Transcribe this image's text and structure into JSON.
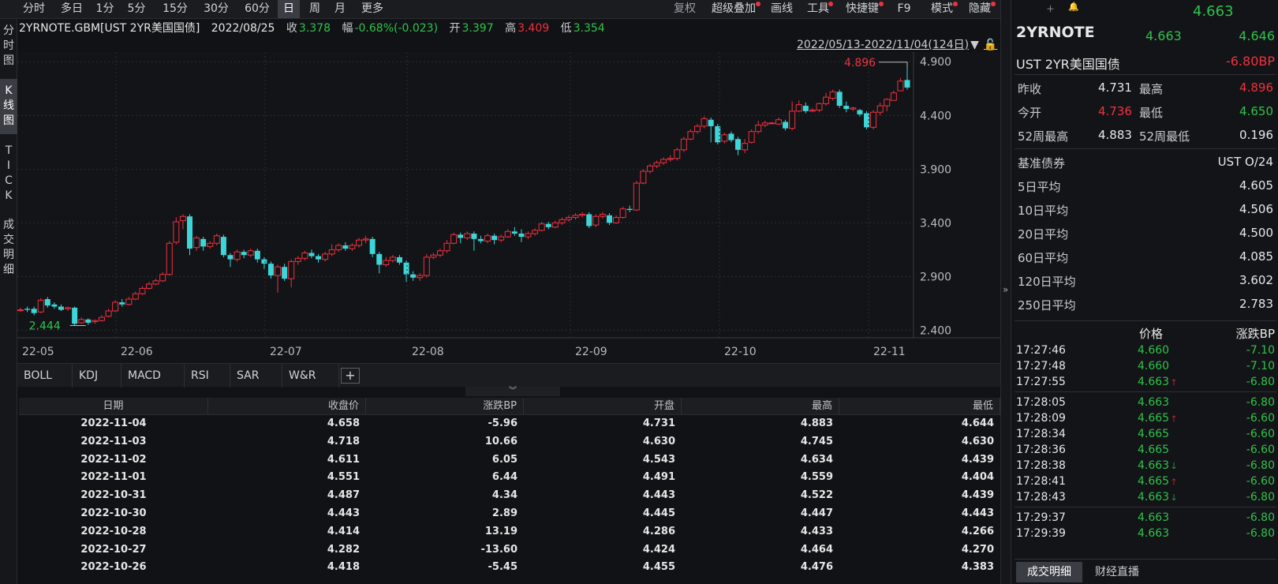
{
  "toolbar": {
    "periods": [
      "分时",
      "多日",
      "1分",
      "5分",
      "15分",
      "30分",
      "60分",
      "日",
      "周",
      "月",
      "更多"
    ],
    "active_period": "日",
    "tools": [
      "复权",
      "超级叠加",
      "画线",
      "工具",
      "快捷键",
      "F9",
      "模式",
      "隐藏"
    ]
  },
  "left_tabs": {
    "t1": "分时图",
    "t2": "K线图",
    "t3": "TICK",
    "t4": "成交明细",
    "active": "K线图"
  },
  "info": {
    "code": "2YRNOTE.GBM[UST 2YR美国国债]",
    "date": "2022/08/25",
    "close_label": "收",
    "close": "3.378",
    "change_label": "幅",
    "change": "-0.68%(-0.023)",
    "open_label": "开",
    "open": "3.397",
    "high_label": "高",
    "high": "3.409",
    "low_label": "低",
    "low": "3.354"
  },
  "range_text": "2022/05/13-2022/11/04(124日)",
  "chart_data": {
    "type": "candlestick",
    "y_ticks": [
      "4.900",
      "4.400",
      "3.900",
      "3.400",
      "2.900",
      "2.400"
    ],
    "x_labels": [
      "22-05",
      "22-06",
      "22-07",
      "22-08",
      "22-09",
      "22-10",
      "22-11"
    ],
    "ylim": [
      2.33,
      4.99
    ],
    "max_label": "4.896",
    "min_label": "2.444",
    "candles": [
      [
        2.59,
        2.59,
        2.61,
        2.57
      ],
      [
        2.6,
        2.59,
        2.62,
        2.57
      ],
      [
        2.6,
        2.56,
        2.62,
        2.54
      ],
      [
        2.57,
        2.68,
        2.7,
        2.56
      ],
      [
        2.69,
        2.63,
        2.71,
        2.61
      ],
      [
        2.64,
        2.62,
        2.66,
        2.6
      ],
      [
        2.62,
        2.59,
        2.64,
        2.58
      ],
      [
        2.6,
        2.61,
        2.62,
        2.58
      ],
      [
        2.61,
        2.46,
        2.62,
        2.44
      ],
      [
        2.47,
        2.5,
        2.52,
        2.46
      ],
      [
        2.5,
        2.47,
        2.51,
        2.45
      ],
      [
        2.48,
        2.49,
        2.5,
        2.46
      ],
      [
        2.49,
        2.52,
        2.54,
        2.48
      ],
      [
        2.53,
        2.58,
        2.6,
        2.52
      ],
      [
        2.58,
        2.66,
        2.68,
        2.57
      ],
      [
        2.66,
        2.64,
        2.69,
        2.62
      ],
      [
        2.64,
        2.69,
        2.71,
        2.63
      ],
      [
        2.69,
        2.74,
        2.76,
        2.68
      ],
      [
        2.74,
        2.79,
        2.81,
        2.73
      ],
      [
        2.79,
        2.83,
        2.85,
        2.78
      ],
      [
        2.83,
        2.86,
        2.88,
        2.82
      ],
      [
        2.86,
        2.92,
        2.94,
        2.85
      ],
      [
        2.92,
        3.21,
        3.23,
        2.91
      ],
      [
        3.22,
        3.41,
        3.45,
        3.2
      ],
      [
        3.42,
        3.46,
        3.48,
        3.34
      ],
      [
        3.46,
        3.16,
        3.48,
        3.1
      ],
      [
        3.17,
        3.26,
        3.28,
        3.14
      ],
      [
        3.25,
        3.18,
        3.27,
        3.14
      ],
      [
        3.18,
        3.21,
        3.23,
        3.16
      ],
      [
        3.21,
        3.28,
        3.3,
        3.19
      ],
      [
        3.27,
        3.1,
        3.29,
        3.08
      ],
      [
        3.1,
        3.06,
        3.12,
        2.99
      ],
      [
        3.06,
        3.13,
        3.15,
        3.04
      ],
      [
        3.13,
        3.1,
        3.15,
        3.07
      ],
      [
        3.1,
        3.14,
        3.16,
        3.08
      ],
      [
        3.14,
        3.06,
        3.16,
        3.03
      ],
      [
        3.06,
        3.02,
        3.08,
        2.97
      ],
      [
        3.02,
        2.91,
        3.04,
        2.88
      ],
      [
        2.91,
        2.99,
        3.01,
        2.75
      ],
      [
        2.99,
        2.88,
        3.02,
        2.86
      ],
      [
        2.88,
        3.04,
        3.06,
        2.8
      ],
      [
        3.04,
        3.07,
        3.09,
        3.01
      ],
      [
        3.07,
        3.12,
        3.14,
        3.05
      ],
      [
        3.12,
        3.09,
        3.15,
        3.07
      ],
      [
        3.09,
        3.06,
        3.11,
        3.03
      ],
      [
        3.06,
        3.11,
        3.13,
        3.04
      ],
      [
        3.11,
        3.15,
        3.2,
        3.09
      ],
      [
        3.15,
        3.19,
        3.21,
        3.13
      ],
      [
        3.19,
        3.16,
        3.22,
        3.14
      ],
      [
        3.16,
        3.19,
        3.21,
        3.14
      ],
      [
        3.19,
        3.24,
        3.26,
        3.17
      ],
      [
        3.24,
        3.25,
        3.28,
        3.21
      ],
      [
        3.25,
        3.11,
        3.27,
        3.08
      ],
      [
        3.11,
        3.01,
        3.13,
        2.93
      ],
      [
        3.01,
        3.05,
        3.08,
        2.99
      ],
      [
        3.05,
        3.08,
        3.1,
        3.03
      ],
      [
        3.08,
        3.03,
        3.1,
        3.01
      ],
      [
        3.03,
        2.92,
        3.05,
        2.85
      ],
      [
        2.92,
        2.89,
        2.95,
        2.86
      ],
      [
        2.89,
        2.91,
        2.93,
        2.86
      ],
      [
        2.91,
        3.08,
        3.11,
        2.89
      ],
      [
        3.08,
        3.1,
        3.12,
        3.06
      ],
      [
        3.1,
        3.14,
        3.16,
        3.08
      ],
      [
        3.14,
        3.21,
        3.24,
        3.12
      ],
      [
        3.21,
        3.29,
        3.31,
        3.2
      ],
      [
        3.29,
        3.26,
        3.31,
        3.21
      ],
      [
        3.26,
        3.3,
        3.32,
        3.24
      ],
      [
        3.3,
        3.25,
        3.32,
        3.14
      ],
      [
        3.25,
        3.23,
        3.28,
        3.21
      ],
      [
        3.23,
        3.28,
        3.3,
        3.21
      ],
      [
        3.28,
        3.24,
        3.3,
        3.2
      ],
      [
        3.24,
        3.27,
        3.29,
        3.22
      ],
      [
        3.27,
        3.32,
        3.34,
        3.26
      ],
      [
        3.32,
        3.3,
        3.36,
        3.28
      ],
      [
        3.3,
        3.27,
        3.34,
        3.22
      ],
      [
        3.27,
        3.3,
        3.32,
        3.25
      ],
      [
        3.3,
        3.33,
        3.35,
        3.28
      ],
      [
        3.33,
        3.39,
        3.41,
        3.32
      ],
      [
        3.39,
        3.36,
        3.41,
        3.34
      ],
      [
        3.36,
        3.4,
        3.42,
        3.35
      ],
      [
        3.4,
        3.43,
        3.45,
        3.38
      ],
      [
        3.43,
        3.45,
        3.47,
        3.41
      ],
      [
        3.45,
        3.47,
        3.49,
        3.43
      ],
      [
        3.47,
        3.48,
        3.5,
        3.45
      ],
      [
        3.48,
        3.37,
        3.5,
        3.35
      ],
      [
        3.38,
        3.46,
        3.48,
        3.36
      ],
      [
        3.46,
        3.48,
        3.5,
        3.44
      ],
      [
        3.47,
        3.4,
        3.49,
        3.38
      ],
      [
        3.4,
        3.45,
        3.47,
        3.39
      ],
      [
        3.45,
        3.53,
        3.55,
        3.44
      ],
      [
        3.53,
        3.52,
        3.56,
        3.5
      ],
      [
        3.52,
        3.77,
        3.79,
        3.51
      ],
      [
        3.77,
        3.88,
        3.9,
        3.76
      ],
      [
        3.88,
        3.93,
        3.95,
        3.86
      ],
      [
        3.93,
        3.96,
        3.98,
        3.91
      ],
      [
        3.96,
        3.99,
        4.01,
        3.94
      ],
      [
        3.99,
        4.0,
        4.03,
        3.97
      ],
      [
        4.0,
        4.08,
        4.1,
        3.98
      ],
      [
        4.08,
        4.18,
        4.2,
        4.06
      ],
      [
        4.18,
        4.25,
        4.27,
        4.17
      ],
      [
        4.25,
        4.3,
        4.32,
        4.23
      ],
      [
        4.3,
        4.37,
        4.39,
        4.28
      ],
      [
        4.36,
        4.3,
        4.38,
        4.15
      ],
      [
        4.3,
        4.15,
        4.32,
        4.13
      ],
      [
        4.16,
        4.22,
        4.24,
        4.14
      ],
      [
        4.23,
        4.17,
        4.25,
        4.15
      ],
      [
        4.18,
        4.08,
        4.2,
        4.03
      ],
      [
        4.08,
        4.14,
        4.18,
        4.05
      ],
      [
        4.15,
        4.25,
        4.27,
        4.14
      ],
      [
        4.25,
        4.31,
        4.35,
        4.23
      ],
      [
        4.31,
        4.33,
        4.35,
        4.29
      ],
      [
        4.33,
        4.33,
        4.34,
        4.32
      ],
      [
        4.32,
        4.36,
        4.38,
        4.31
      ],
      [
        4.34,
        4.28,
        4.36,
        4.26
      ],
      [
        4.28,
        4.44,
        4.53,
        4.26
      ],
      [
        4.44,
        4.5,
        4.54,
        4.43
      ],
      [
        4.49,
        4.44,
        4.52,
        4.42
      ],
      [
        4.44,
        4.45,
        4.47,
        4.43
      ],
      [
        4.45,
        4.51,
        4.52,
        4.43
      ],
      [
        4.51,
        4.57,
        4.61,
        4.49
      ],
      [
        4.56,
        4.62,
        4.64,
        4.54
      ],
      [
        4.62,
        4.49,
        4.64,
        4.47
      ],
      [
        4.49,
        4.46,
        4.53,
        4.43
      ],
      [
        4.46,
        4.47,
        4.48,
        4.44
      ],
      [
        4.45,
        4.41,
        4.46,
        4.39
      ],
      [
        4.42,
        4.29,
        4.44,
        4.27
      ],
      [
        4.29,
        4.43,
        4.45,
        4.27
      ],
      [
        4.43,
        4.49,
        4.52,
        4.4
      ],
      [
        4.49,
        4.55,
        4.56,
        4.44
      ],
      [
        4.54,
        4.61,
        4.63,
        4.54
      ],
      [
        4.63,
        4.72,
        4.75,
        4.63
      ],
      [
        4.73,
        4.66,
        4.9,
        4.64
      ]
    ]
  },
  "indicator_tabs": [
    "BOLL",
    "KDJ",
    "MACD",
    "RSI",
    "SAR",
    "W&R"
  ],
  "table": {
    "headers": [
      "日期",
      "收盘价",
      "涨跌BP",
      "开盘",
      "最高",
      "最低"
    ],
    "rows": [
      [
        "2022-11-04",
        "4.658",
        "-5.96",
        "4.731",
        "4.883",
        "4.644"
      ],
      [
        "2022-11-03",
        "4.718",
        "10.66",
        "4.630",
        "4.745",
        "4.630"
      ],
      [
        "2022-11-02",
        "4.611",
        "6.05",
        "4.543",
        "4.634",
        "4.439"
      ],
      [
        "2022-11-01",
        "4.551",
        "6.44",
        "4.491",
        "4.559",
        "4.404"
      ],
      [
        "2022-10-31",
        "4.487",
        "4.34",
        "4.443",
        "4.522",
        "4.439"
      ],
      [
        "2022-10-30",
        "4.443",
        "2.89",
        "4.445",
        "4.447",
        "4.443"
      ],
      [
        "2022-10-28",
        "4.414",
        "13.19",
        "4.286",
        "4.433",
        "4.266"
      ],
      [
        "2022-10-27",
        "4.282",
        "-13.60",
        "4.424",
        "4.464",
        "4.270"
      ],
      [
        "2022-10-26",
        "4.418",
        "-5.45",
        "4.455",
        "4.476",
        "4.383"
      ]
    ]
  },
  "quote": {
    "top_price": "4.663",
    "name": "2YRNOTE",
    "bid": "4.663",
    "ask": "4.646",
    "full_name": "UST 2YR美国国债",
    "change_bp": "-6.80BP",
    "prev_close_label": "昨收",
    "prev_close": "4.731",
    "high_label": "最高",
    "high": "4.896",
    "open_label": "今开",
    "open": "4.736",
    "low_label": "最低",
    "low": "4.650",
    "w52_high_label": "52周最高",
    "w52_high": "4.883",
    "w52_low_label": "52周最低",
    "w52_low": "0.196",
    "bench_label": "基准债券",
    "bench": "UST O/24",
    "averages": [
      {
        "label": "5日平均",
        "value": "4.605"
      },
      {
        "label": "10日平均",
        "value": "4.506"
      },
      {
        "label": "20日平均",
        "value": "4.500"
      },
      {
        "label": "60日平均",
        "value": "4.085"
      },
      {
        "label": "120日平均",
        "value": "3.602"
      },
      {
        "label": "250日平均",
        "value": "2.783"
      }
    ]
  },
  "ticks": {
    "price_header": "价格",
    "bp_header": "涨跌BP",
    "rows": [
      {
        "time": "17:27:46",
        "price": "4.660",
        "arrow": "",
        "bp": "-7.10"
      },
      {
        "time": "17:27:48",
        "price": "4.660",
        "arrow": "",
        "bp": "-7.10"
      },
      {
        "time": "17:27:55",
        "price": "4.663",
        "arrow": "up",
        "bp": "-6.80"
      },
      {
        "time": "17:28:05",
        "price": "4.663",
        "arrow": "",
        "bp": "-6.80"
      },
      {
        "time": "17:28:09",
        "price": "4.665",
        "arrow": "up",
        "bp": "-6.60"
      },
      {
        "time": "17:28:34",
        "price": "4.665",
        "arrow": "",
        "bp": "-6.60"
      },
      {
        "time": "17:28:36",
        "price": "4.665",
        "arrow": "",
        "bp": "-6.60"
      },
      {
        "time": "17:28:38",
        "price": "4.663",
        "arrow": "down",
        "bp": "-6.80"
      },
      {
        "time": "17:28:41",
        "price": "4.665",
        "arrow": "up",
        "bp": "-6.60"
      },
      {
        "time": "17:28:43",
        "price": "4.663",
        "arrow": "down",
        "bp": "-6.80"
      },
      {
        "time": "17:29:37",
        "price": "4.663",
        "arrow": "",
        "bp": "-6.80"
      },
      {
        "time": "17:29:39",
        "price": "4.663",
        "arrow": "",
        "bp": "-6.80"
      }
    ]
  },
  "bottom_tabs": [
    "成交明细",
    "财经直播"
  ],
  "colors": {
    "up": "#f0313f",
    "down": "#3dd5d8",
    "grid": "#2a2c31",
    "green": "#2fc24b"
  }
}
